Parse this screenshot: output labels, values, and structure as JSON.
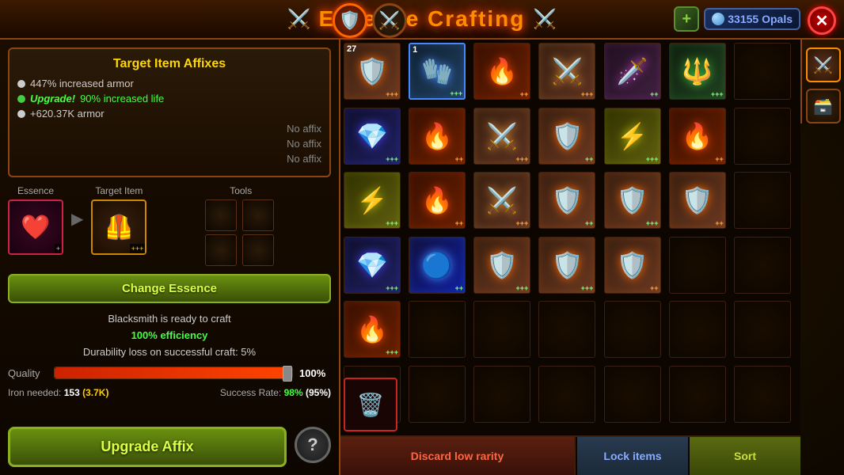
{
  "title": "Essence Crafting",
  "header": {
    "title": "Essence Crafting",
    "opals": "33155 Opals",
    "add_label": "+",
    "close_label": "✕"
  },
  "left_panel": {
    "affixes_title": "Target Item Affixes",
    "affixes": [
      {
        "color": "white",
        "text": "447% increased armor"
      },
      {
        "color": "green",
        "prefix": "Upgrade!",
        "text": " 90% increased life"
      },
      {
        "color": "white",
        "text": "+620.37K armor"
      }
    ],
    "no_affixes": [
      "No affix",
      "No affix",
      "No affix"
    ],
    "essence_label": "Essence",
    "target_label": "Target Item",
    "tools_label": "Tools",
    "change_essence_btn": "Change Essence",
    "craft_status": "Blacksmith is ready to craft",
    "efficiency_label": "100% efficiency",
    "durability_text": "Durability loss on successful craft: 5%",
    "quality_label": "Quality",
    "quality_pct": "100%",
    "iron_text": "Iron needed:",
    "iron_val": "153",
    "iron_extra": "(3.7K)",
    "success_text": "Success Rate:",
    "success_val": "98%",
    "success_extra": "(95%)",
    "upgrade_btn": "Upgrade Affix",
    "help_btn": "?"
  },
  "inventory": {
    "items": [
      {
        "id": 1,
        "has_item": true,
        "icon": "🛡️",
        "badge": "+++",
        "badge_color": "orange",
        "count": "27"
      },
      {
        "id": 2,
        "has_item": true,
        "icon": "🧤",
        "badge": "+++",
        "badge_color": "green",
        "count": "1",
        "selected": true
      },
      {
        "id": 3,
        "has_item": true,
        "icon": "🔥",
        "badge": "++",
        "badge_color": "orange"
      },
      {
        "id": 4,
        "has_item": true,
        "icon": "⚔️",
        "badge": "+++",
        "badge_color": "orange"
      },
      {
        "id": 5,
        "has_item": true,
        "icon": "🗡️",
        "badge": "++",
        "badge_color": "green"
      },
      {
        "id": 6,
        "has_item": true,
        "icon": "🔱",
        "badge": "+++",
        "badge_color": "green"
      },
      {
        "id": 7,
        "has_item": false
      },
      {
        "id": 8,
        "has_item": true,
        "icon": "💎",
        "badge": "+++",
        "badge_color": "green"
      },
      {
        "id": 9,
        "has_item": true,
        "icon": "🔥",
        "badge": "++",
        "badge_color": "orange"
      },
      {
        "id": 10,
        "has_item": true,
        "icon": "⚔️",
        "badge": "+++",
        "badge_color": "orange"
      },
      {
        "id": 11,
        "has_item": true,
        "icon": "🛡️",
        "badge": "++",
        "badge_color": "green"
      },
      {
        "id": 12,
        "has_item": true,
        "icon": "⚡",
        "badge": "+++",
        "badge_color": "green"
      },
      {
        "id": 13,
        "has_item": true,
        "icon": "🔥",
        "badge": "++",
        "badge_color": "orange"
      },
      {
        "id": 14,
        "has_item": false
      },
      {
        "id": 15,
        "has_item": true,
        "icon": "⚡",
        "badge": "+++",
        "badge_color": "green"
      },
      {
        "id": 16,
        "has_item": true,
        "icon": "🔥",
        "badge": "++",
        "badge_color": "orange"
      },
      {
        "id": 17,
        "has_item": true,
        "icon": "⚔️",
        "badge": "+++",
        "badge_color": "orange"
      },
      {
        "id": 18,
        "has_item": true,
        "icon": "🛡️",
        "badge": "++",
        "badge_color": "green"
      },
      {
        "id": 19,
        "has_item": true,
        "icon": "🛡️",
        "badge": "+++",
        "badge_color": "green"
      },
      {
        "id": 20,
        "has_item": true,
        "icon": "🛡️",
        "badge": "++",
        "badge_color": "orange"
      },
      {
        "id": 21,
        "has_item": false
      },
      {
        "id": 22,
        "has_item": true,
        "icon": "💎",
        "badge": "+++",
        "badge_color": "green"
      },
      {
        "id": 23,
        "has_item": true,
        "icon": "🔵",
        "badge": "++",
        "badge_color": "green"
      },
      {
        "id": 24,
        "has_item": true,
        "icon": "🛡️",
        "badge": "+++",
        "badge_color": "green"
      },
      {
        "id": 25,
        "has_item": true,
        "icon": "🛡️",
        "badge": "+++",
        "badge_color": "green"
      },
      {
        "id": 26,
        "has_item": true,
        "icon": "🛡️",
        "badge": "++",
        "badge_color": "orange"
      },
      {
        "id": 27,
        "has_item": false
      },
      {
        "id": 28,
        "has_item": false
      },
      {
        "id": 29,
        "has_item": true,
        "icon": "🔥",
        "badge": "+++",
        "badge_color": "green"
      },
      {
        "id": 30,
        "has_item": false
      },
      {
        "id": 31,
        "has_item": false
      },
      {
        "id": 32,
        "has_item": false
      },
      {
        "id": 33,
        "has_item": false
      },
      {
        "id": 34,
        "has_item": false
      },
      {
        "id": 35,
        "has_item": false
      },
      {
        "id": 36,
        "has_item": false
      },
      {
        "id": 37,
        "has_item": false
      },
      {
        "id": 38,
        "has_item": false
      },
      {
        "id": 39,
        "has_item": false
      },
      {
        "id": 40,
        "has_item": false
      },
      {
        "id": 41,
        "has_item": false
      },
      {
        "id": 42,
        "has_item": false
      }
    ],
    "discard_btn": "Discard low rarity",
    "lock_btn": "Lock items",
    "sort_btn": "Sort"
  }
}
